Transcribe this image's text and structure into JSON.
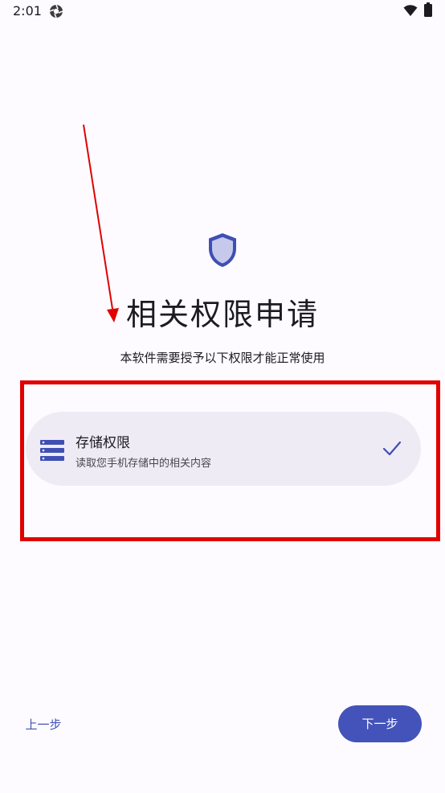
{
  "status_bar": {
    "time": "2:01",
    "app_icon": "aperture-icon",
    "wifi_icon": "wifi-icon",
    "battery_icon": "battery-icon"
  },
  "header": {
    "icon": "shield-icon",
    "title": "相关权限申请",
    "subtitle": "本软件需要授予以下权限才能正常使用"
  },
  "permissions": [
    {
      "icon": "storage-icon",
      "title": "存储权限",
      "description": "读取您手机存储中的相关内容",
      "granted": true,
      "status_icon": "check-icon"
    }
  ],
  "footer": {
    "prev_label": "上一步",
    "next_label": "下一步"
  },
  "colors": {
    "accent": "#4353b9",
    "card_bg": "#efebf5",
    "background": "#fdfbff",
    "annotation": "#e00000"
  }
}
